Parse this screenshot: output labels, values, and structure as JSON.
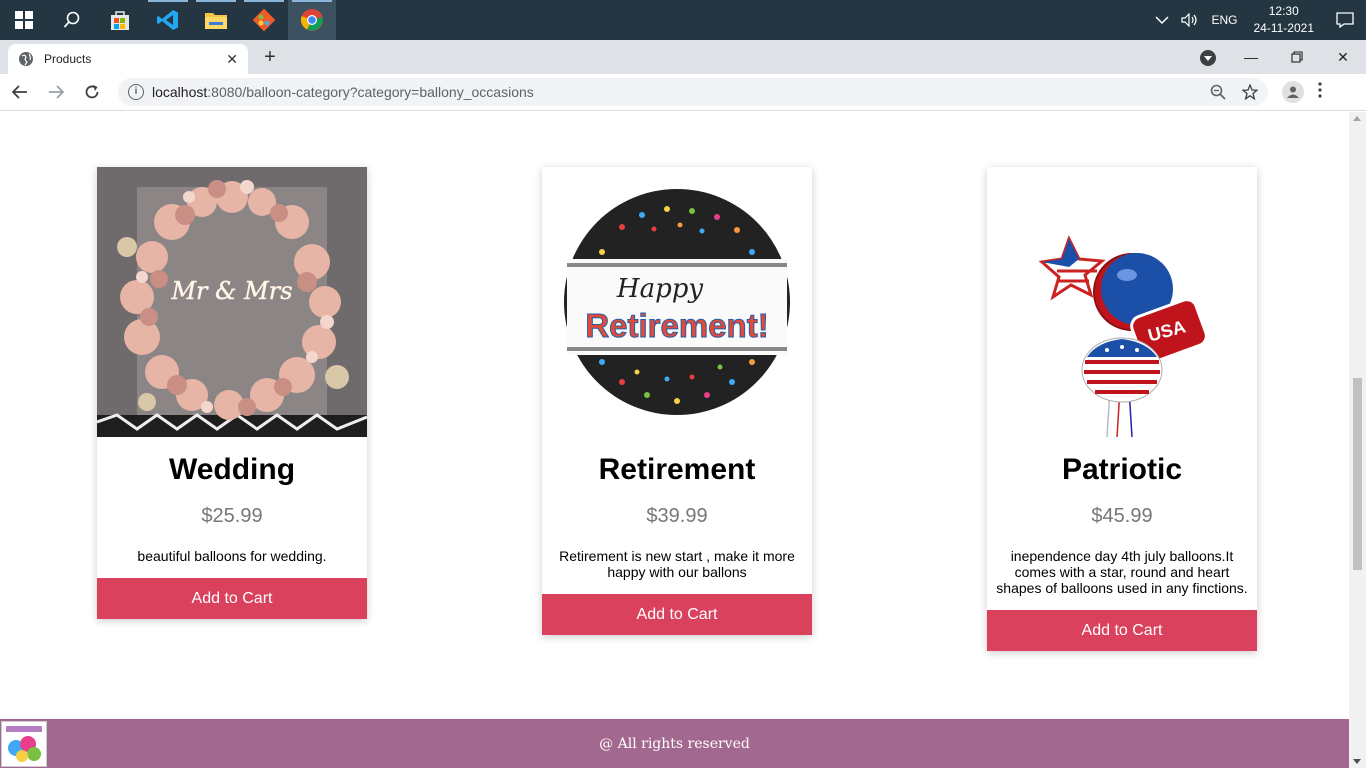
{
  "taskbar": {
    "tray": {
      "language": "ENG",
      "time": "12:30",
      "date": "24-11-2021"
    }
  },
  "browser": {
    "tab_title": "Products",
    "url_host": "localhost",
    "url_path": ":8080/balloon-category?category=ballony_occasions"
  },
  "products": [
    {
      "name": "Wedding",
      "price": "$25.99",
      "description": "beautiful balloons for wedding.",
      "button": "Add to Cart"
    },
    {
      "name": "Retirement",
      "price": "$39.99",
      "description": "Retirement is new start , make it more happy with our ballons",
      "button": "Add to Cart"
    },
    {
      "name": "Patriotic",
      "price": "$45.99",
      "description": "inependence day 4th july balloons.It comes with a star, round and heart shapes of balloons used in any finctions.",
      "button": "Add to Cart"
    }
  ],
  "retirement_image": {
    "line1": "Happy",
    "line2": "Retirement!"
  },
  "patriotic_image": {
    "badge": "USA"
  },
  "footer": {
    "copyright": "@ All rights reserved"
  },
  "colors": {
    "button": "#d9415d",
    "footer": "#a3688f",
    "taskbar": "#243642"
  }
}
